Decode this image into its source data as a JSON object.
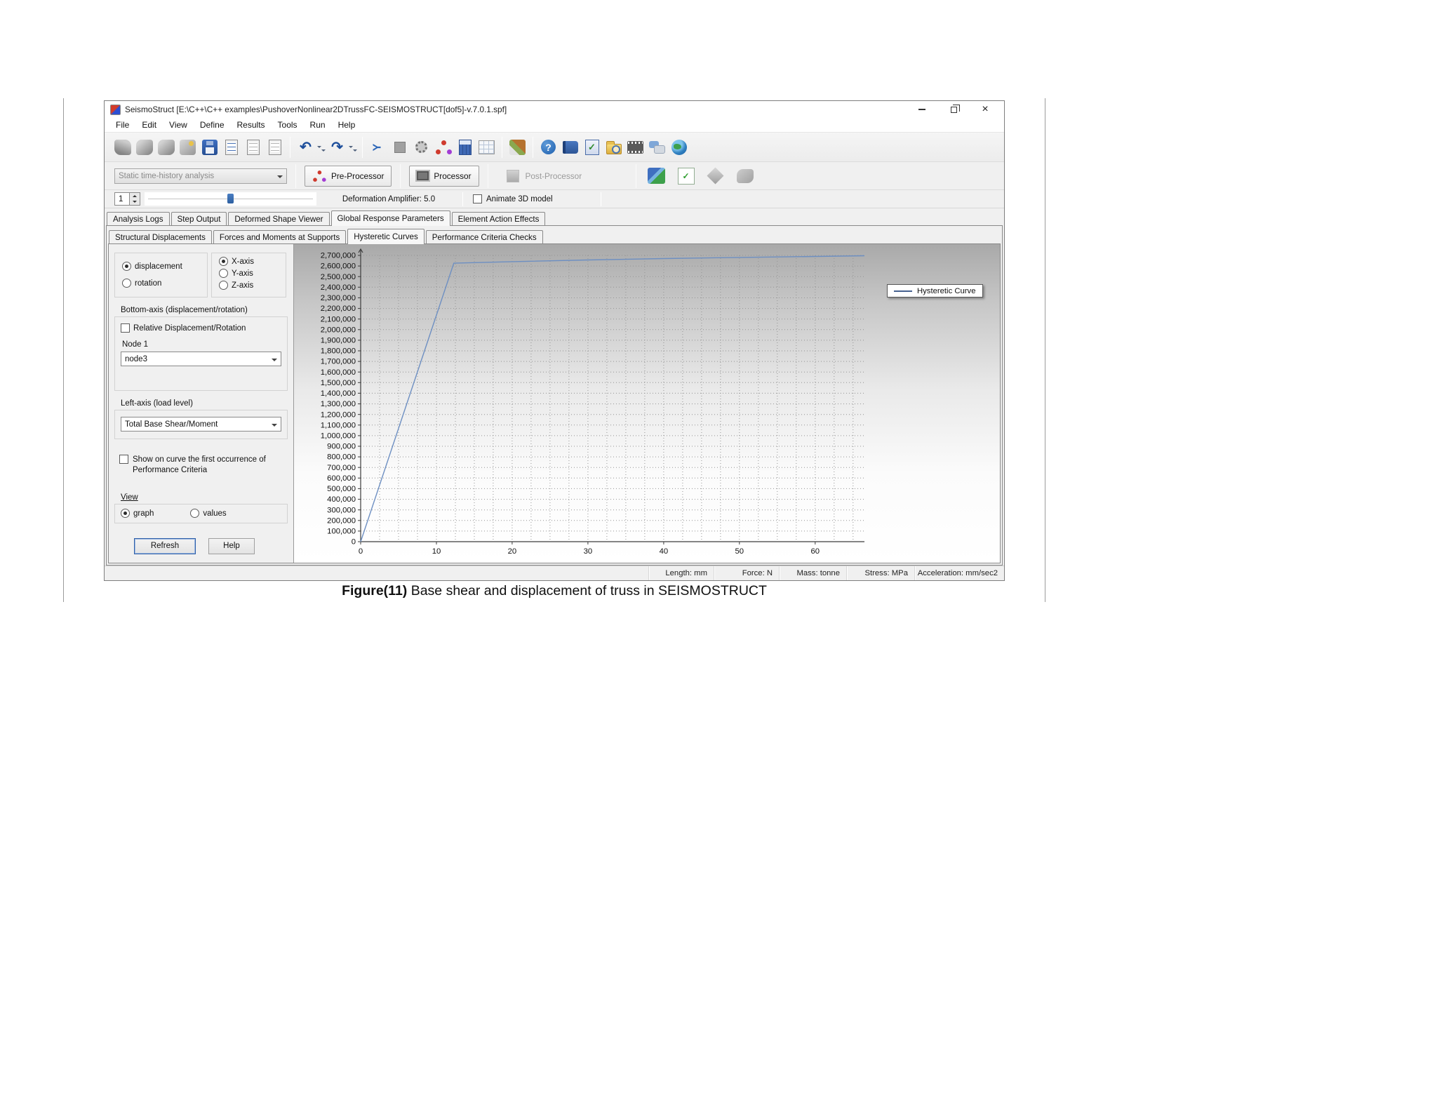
{
  "titlebar": {
    "title": "SeismoStruct  [E:\\C++\\C++ examples\\PushoverNonlinear2DTrussFC-SEISMOSTRUCT[dof5]-v.7.0.1.spf]"
  },
  "menu": {
    "items": [
      "File",
      "Edit",
      "View",
      "Define",
      "Results",
      "Tools",
      "Run",
      "Help"
    ]
  },
  "toolbar": {
    "icons": [
      {
        "name": "new-model-icon",
        "kind": "blob-arrow"
      },
      {
        "name": "open-model-icon",
        "kind": "blob"
      },
      {
        "name": "import-model-icon",
        "kind": "blob"
      },
      {
        "name": "wizard-icon",
        "kind": "wand"
      },
      {
        "name": "save-icon",
        "kind": "floppy"
      },
      {
        "name": "report-icon",
        "kind": "doc-blue"
      },
      {
        "name": "copy-icon",
        "kind": "doc"
      },
      {
        "name": "paste-icon",
        "kind": "doc"
      },
      {
        "name": "toolbar-separator",
        "kind": "sep"
      },
      {
        "name": "undo-icon",
        "kind": "undo",
        "glyph": "↶"
      },
      {
        "name": "undo-menu-caret",
        "kind": "caret"
      },
      {
        "name": "redo-icon",
        "kind": "redo",
        "glyph": "↷"
      },
      {
        "name": "redo-menu-caret",
        "kind": "caret"
      },
      {
        "name": "toolbar-separator",
        "kind": "sep"
      },
      {
        "name": "branch-icon",
        "kind": "branch",
        "glyph": "Y"
      },
      {
        "name": "stop-icon",
        "kind": "square"
      },
      {
        "name": "settings-gear-icon",
        "kind": "gear"
      },
      {
        "name": "nodes-icon",
        "kind": "molecule"
      },
      {
        "name": "calculator-icon",
        "kind": "calc"
      },
      {
        "name": "grid-icon",
        "kind": "grid"
      },
      {
        "name": "toolbar-separator",
        "kind": "sep"
      },
      {
        "name": "paintbrush-icon",
        "kind": "brush"
      },
      {
        "name": "toolbar-separator",
        "kind": "sep"
      },
      {
        "name": "help-icon",
        "kind": "help",
        "glyph": "?"
      },
      {
        "name": "manual-book-icon",
        "kind": "book"
      },
      {
        "name": "check-document-icon",
        "kind": "bookcheck",
        "glyph": "✓"
      },
      {
        "name": "search-folder-icon",
        "kind": "folder"
      },
      {
        "name": "media-icon",
        "kind": "film"
      },
      {
        "name": "feedback-chat-icon",
        "kind": "chat"
      },
      {
        "name": "web-globe-icon",
        "kind": "globe"
      }
    ]
  },
  "toolbar2": {
    "analysis_combo": "Static time-history analysis",
    "pre_processor": "Pre-Processor",
    "processor": "Processor",
    "post_processor": "Post-Processor"
  },
  "toolbar3": {
    "step_value": "1",
    "amplifier_label": "Deformation Amplifier: 5.0",
    "animate_label": "Animate 3D model"
  },
  "tabs_main": {
    "items": [
      "Analysis Logs",
      "Step Output",
      "Deformed Shape Viewer",
      "Global Response Parameters",
      "Element Action Effects"
    ],
    "active": "Global Response Parameters"
  },
  "tabs_sub": {
    "items": [
      "Structural Displacements",
      "Forces and Moments at Supports",
      "Hysteretic Curves",
      "Performance Criteria Checks"
    ],
    "active": "Hysteretic Curves"
  },
  "panel": {
    "displacement_label": "displacement",
    "rotation_label": "rotation",
    "x_axis_label": "X-axis",
    "y_axis_label": "Y-axis",
    "z_axis_label": "Z-axis",
    "bottom_axis_group": "Bottom-axis (displacement/rotation)",
    "relative_label": "Relative Displacement/Rotation",
    "node_label": "Node 1",
    "node_value": "node3",
    "left_axis_group": "Left-axis (load level)",
    "load_value": "Total Base Shear/Moment",
    "show_curve_line1": "Show on curve the first occurrence of",
    "show_curve_line2": "Performance Criteria",
    "view_group": "View",
    "graph_label": "graph",
    "values_label": "values",
    "refresh_button": "Refresh",
    "help_button": "Help"
  },
  "chart_data": {
    "type": "line",
    "title": "",
    "xlabel": "",
    "ylabel": "",
    "xlim": [
      0,
      66.5
    ],
    "ylim": [
      0,
      2700000
    ],
    "x_ticks": [
      0,
      10,
      20,
      30,
      40,
      50,
      60
    ],
    "y_tick_step": 100000,
    "x_minor_step": 2.5,
    "grid": "dotted",
    "legend_position": "right",
    "series": [
      {
        "name": "Hysteretic Curve",
        "color": "#6d8fc2",
        "points": [
          [
            0,
            0
          ],
          [
            12.3,
            2627000
          ],
          [
            20,
            2641000
          ],
          [
            30,
            2657000
          ],
          [
            40,
            2670000
          ],
          [
            50,
            2681000
          ],
          [
            60,
            2690000
          ],
          [
            66.5,
            2697000
          ]
        ]
      }
    ]
  },
  "statusbar": {
    "items": [
      "Length: mm",
      "Force: N",
      "Mass: tonne",
      "Stress: MPa",
      "Acceleration: mm/sec2"
    ]
  },
  "caption": {
    "bold": "Figure(11)",
    "rest": " Base shear and displacement of truss in SEISMOSTRUCT"
  }
}
